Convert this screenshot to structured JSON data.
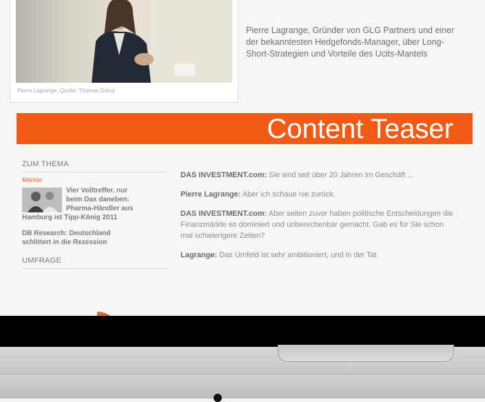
{
  "article_header": {
    "photo_caption": "Pierre Lagrange. Quelle: Thomas Görny",
    "intro": "Pierre Lagrange, Gründer von GLG Partners und einer der bekanntesten Hedgefonds-Manager, über Long-Short-Strategien und Vorteile des Ucits-Mantels"
  },
  "teaser": {
    "label": "Content Teaser",
    "color": "#f05a14"
  },
  "sidebar": {
    "zum_thema": {
      "title": "ZUM THEMA",
      "category": "Märkte",
      "items": [
        {
          "line1": "Vier Volltreffer, nur",
          "line2": "beim Dax daneben:",
          "line3": "Pharma-Händler aus",
          "line4": "Hamburg ist Tipp-König 2011"
        },
        {
          "line1": "DB Research: Deutschland",
          "line2": "schlittert in die Rezession"
        }
      ]
    },
    "umfrage": {
      "title": "UMFRAGE"
    }
  },
  "article": {
    "paragraphs": [
      {
        "speaker": "DAS INVESTMENT.com:",
        "text": " Sie sind seit über 20 Jahren im Geschäft ..."
      },
      {
        "speaker": "Pierre Lagrange:",
        "text": " Aber ich schaue nie zurück."
      },
      {
        "speaker": "DAS INVESTMENT.com:",
        "text": " Aber selten zuvor haben politische Entscheidungen die Finanzmärkte so dominiert und unberechenbar gemacht. Gab es für Sie schon mal schwierigere Zeiten?"
      },
      {
        "speaker": "Lagrange:",
        "text": " Das Umfeld ist sehr ambitioniert, und in der Tat"
      }
    ]
  }
}
